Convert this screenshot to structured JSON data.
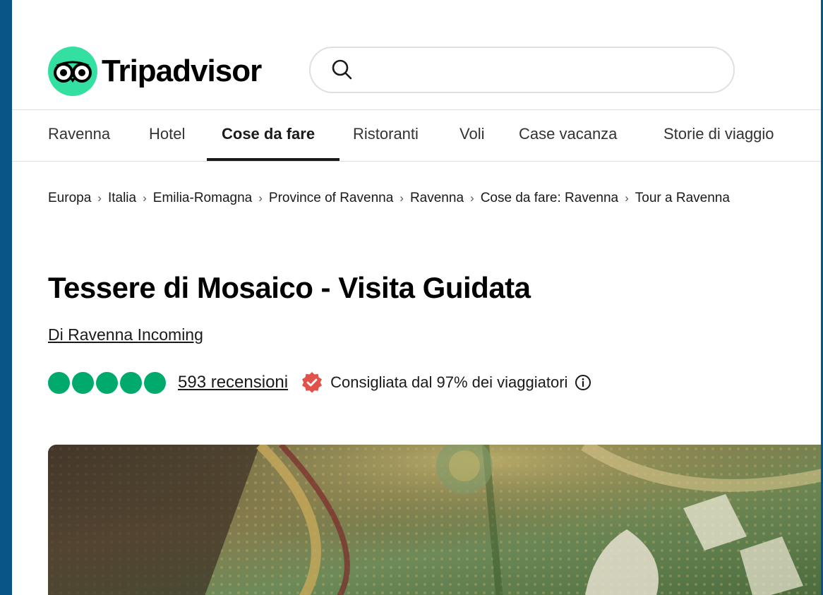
{
  "brand": {
    "name": "Tripadvisor",
    "accent": "#34e0a1",
    "icon": "tripadvisor-owl-icon"
  },
  "search": {
    "value": "",
    "placeholder": "",
    "icon": "search-icon"
  },
  "nav": {
    "items": [
      {
        "label": "Ravenna"
      },
      {
        "label": "Hotel"
      },
      {
        "label": "Cose da fare",
        "active": true
      },
      {
        "label": "Ristoranti"
      },
      {
        "label": "Voli"
      },
      {
        "label": "Case vacanza"
      },
      {
        "label": "Storie di viaggio"
      }
    ]
  },
  "breadcrumb": {
    "items": [
      "Europa",
      "Italia",
      "Emilia-Romagna",
      "Province of Ravenna",
      "Ravenna",
      "Cose da fare: Ravenna",
      "Tour a Ravenna"
    ],
    "separator": "›"
  },
  "listing": {
    "title": "Tessere di Mosaico - Visita Guidata",
    "operator": "Di Ravenna Incoming",
    "rating_bubbles": 5,
    "reviews_label": "593 recensioni",
    "recommendation": "Consigliata dal 97% dei viaggiatori",
    "rating_color": "#00aa6c",
    "badge_color": "#e0524a"
  },
  "hero": {
    "icon": "mosaic-photo"
  }
}
